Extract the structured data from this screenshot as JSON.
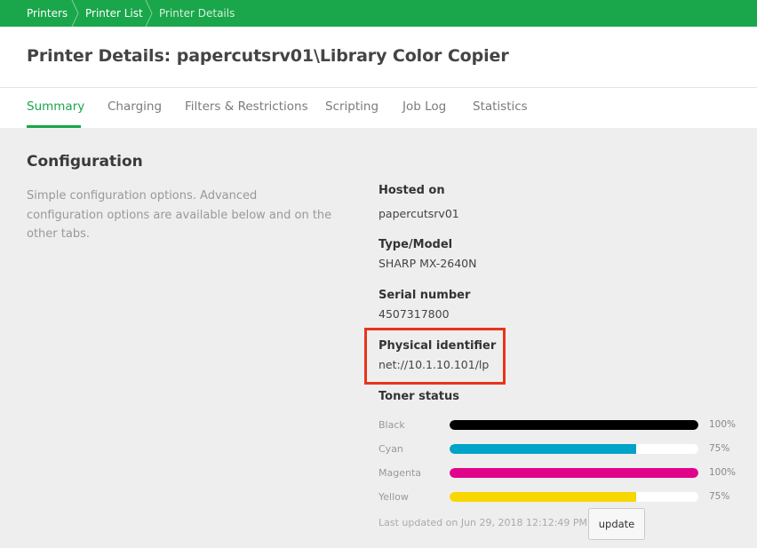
{
  "breadcrumb": {
    "items": [
      {
        "label": "Printers"
      },
      {
        "label": "Printer List"
      },
      {
        "label": "Printer Details"
      }
    ]
  },
  "page": {
    "title": "Printer Details: papercutsrv01\\Library Color Copier"
  },
  "tabs": [
    {
      "label": "Summary",
      "active": true
    },
    {
      "label": "Charging"
    },
    {
      "label": "Filters & Restrictions"
    },
    {
      "label": "Scripting"
    },
    {
      "label": "Job Log"
    },
    {
      "label": "Statistics"
    }
  ],
  "configuration": {
    "title": "Configuration",
    "description": "Simple configuration options. Advanced configuration options are available below and on the other tabs.",
    "hosted_on": {
      "label": "Hosted on",
      "value": "papercutsrv01"
    },
    "type_model": {
      "label": "Type/Model",
      "value": "SHARP MX-2640N"
    },
    "serial_number": {
      "label": "Serial number",
      "value": "4507317800"
    },
    "physical_identifier": {
      "label": "Physical identifier",
      "value": "net://10.1.10.101/lp"
    },
    "toner": {
      "label": "Toner status",
      "items": [
        {
          "name": "Black",
          "percent": 100,
          "percent_label": "100%",
          "color": "#000000"
        },
        {
          "name": "Cyan",
          "percent": 75,
          "percent_label": "75%",
          "color": "#00a3c8"
        },
        {
          "name": "Magenta",
          "percent": 100,
          "percent_label": "100%",
          "color": "#e0048b"
        },
        {
          "name": "Yellow",
          "percent": 75,
          "percent_label": "75%",
          "color": "#f6d700"
        }
      ],
      "last_updated": "Last updated on Jun 29, 2018 12:12:49 PM",
      "update_label": "update"
    }
  },
  "colors": {
    "accent": "#1aa64a",
    "highlight": "#e8341c"
  }
}
